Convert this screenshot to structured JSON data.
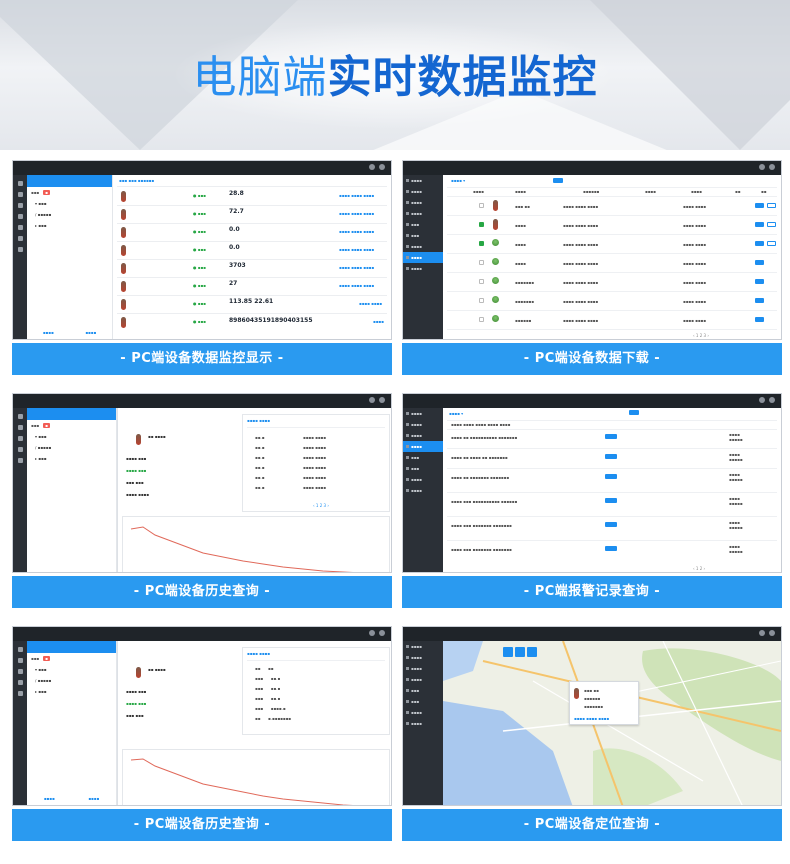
{
  "hero": {
    "title_light": "电脑端",
    "title_bold": "实时数据监控"
  },
  "panels": [
    {
      "caption": "- PC端设备数据监控显示 -"
    },
    {
      "caption": "- PC端设备数据下载 -"
    },
    {
      "caption": "- PC端设备历史查询 -"
    },
    {
      "caption": "- PC端报警记录查询 -"
    },
    {
      "caption": "- PC端设备历史查询 -"
    },
    {
      "caption": "- PC端设备定位查询 -"
    }
  ],
  "monitor": {
    "values": [
      "28.8",
      "72.7",
      "0.0",
      "0.0",
      "3703",
      "27",
      "113.85   22.61",
      "89860435191890403155"
    ]
  },
  "icons": {
    "search": "search-icon",
    "refresh": "refresh-icon",
    "locate": "locate-icon"
  },
  "colors": {
    "accent": "#2a9af0",
    "primary": "#1c8ef0",
    "title_blue": "#1466d1",
    "sidebar": "#2b3037"
  }
}
